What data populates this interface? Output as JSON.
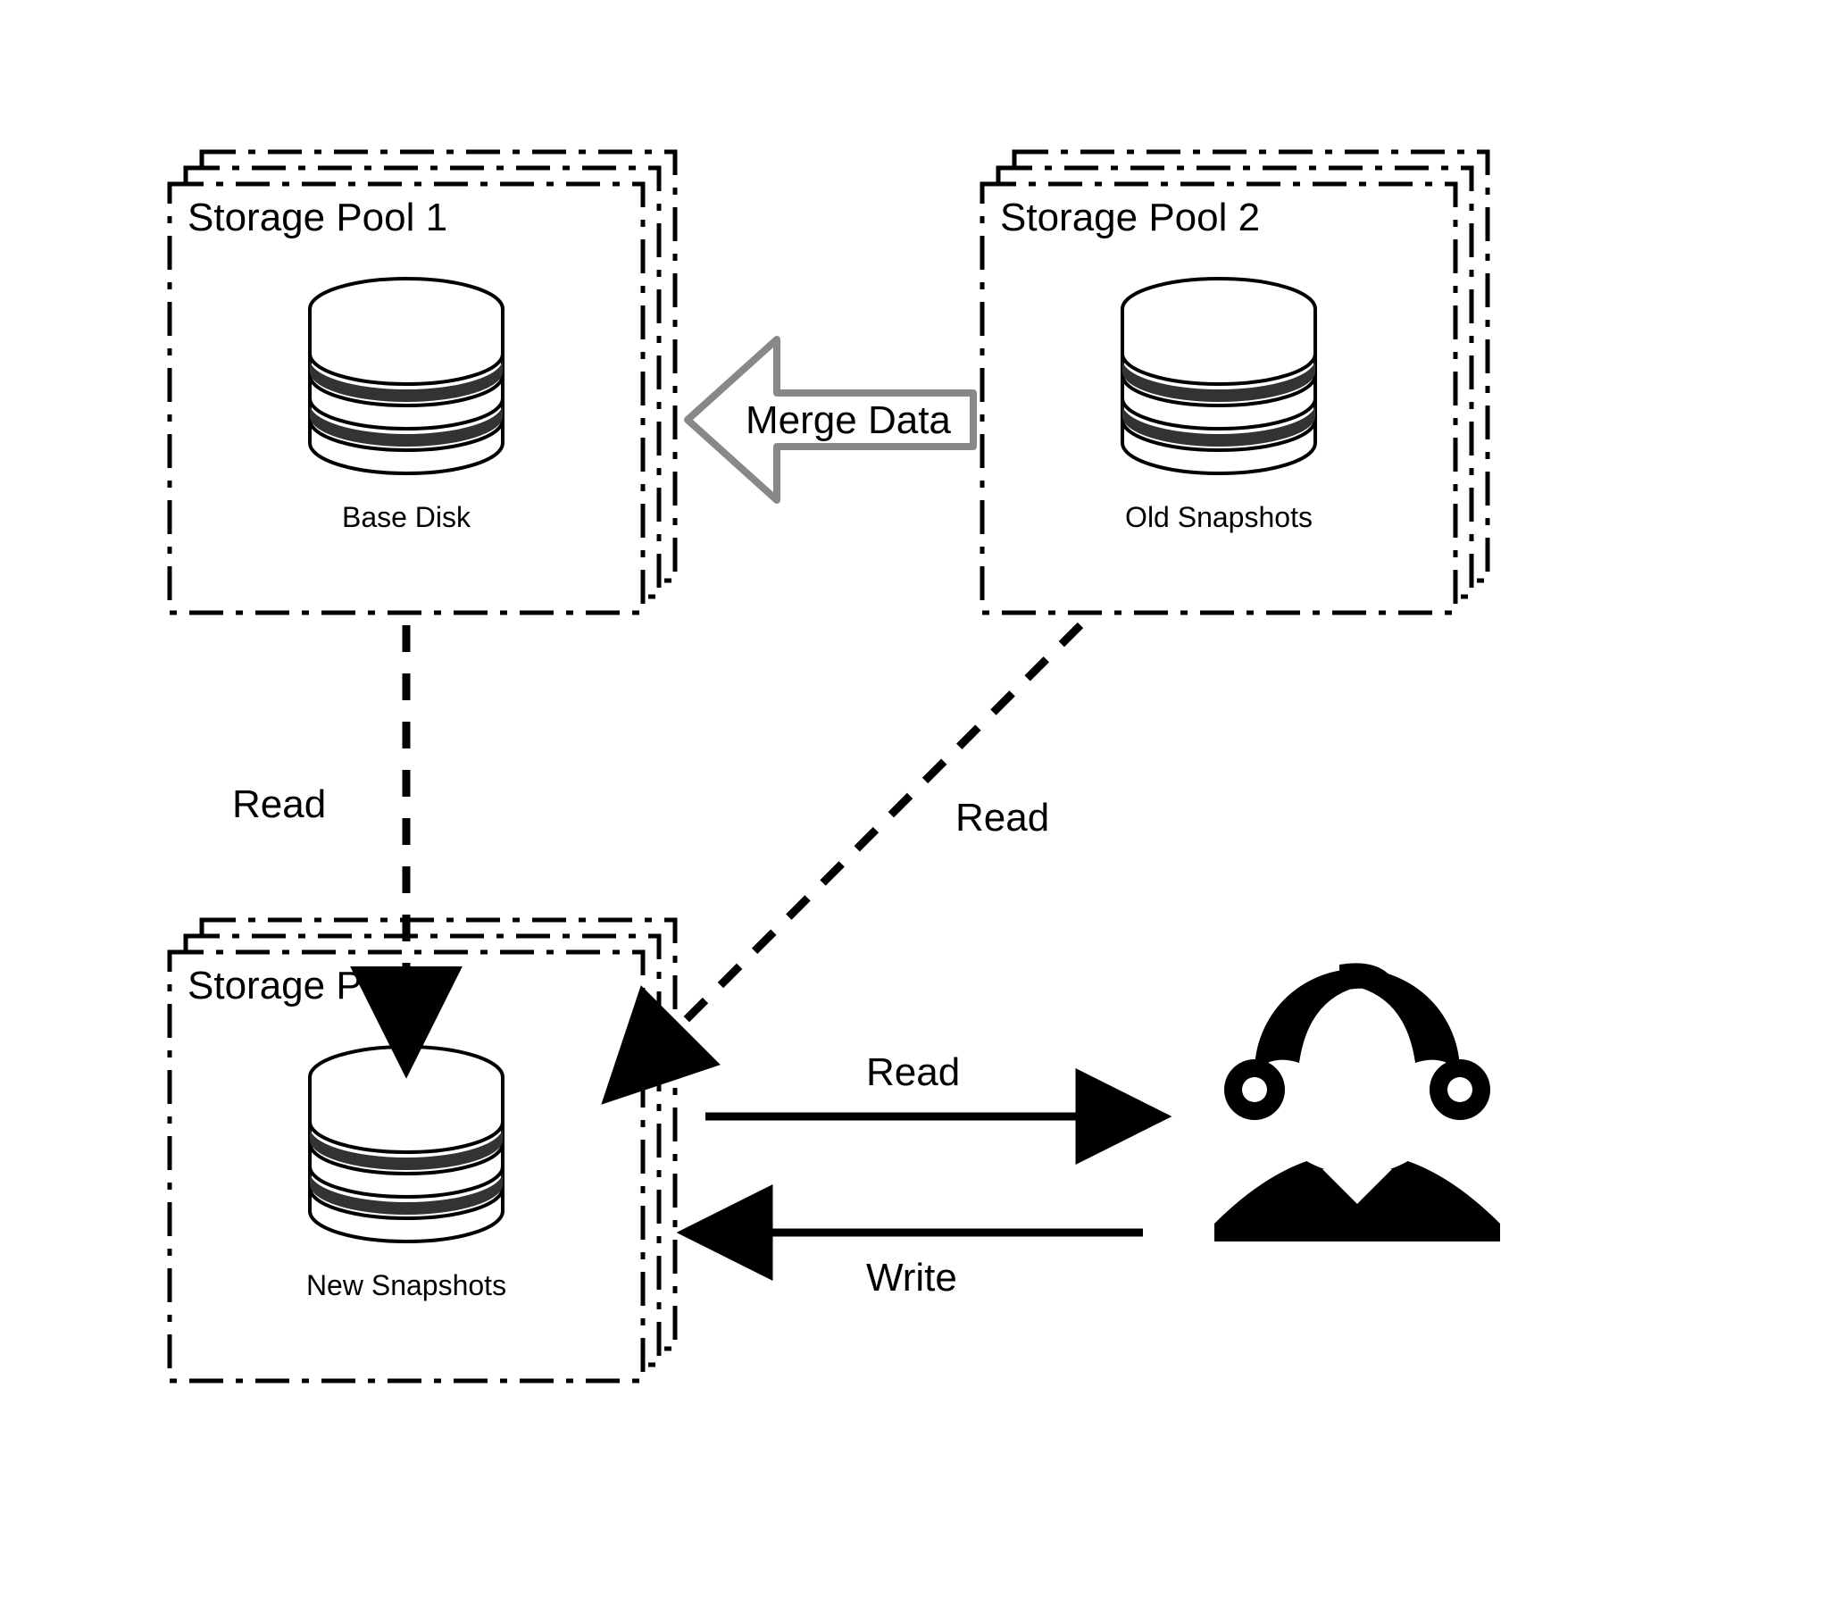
{
  "diagram": {
    "pools": {
      "pool1": {
        "title": "Storage Pool 1",
        "caption": "Base Disk"
      },
      "pool2": {
        "title": "Storage Pool 2",
        "caption": "Old Snapshots"
      },
      "pool3": {
        "title": "Storage Pool 3",
        "caption": "New Snapshots"
      }
    },
    "arrows": {
      "merge": {
        "label": "Merge Data"
      },
      "p1_to_p3": {
        "label": "Read"
      },
      "p2_to_p3": {
        "label": "Read"
      },
      "p3_to_user": {
        "label": "Read"
      },
      "user_to_p3": {
        "label": "Write"
      }
    }
  }
}
